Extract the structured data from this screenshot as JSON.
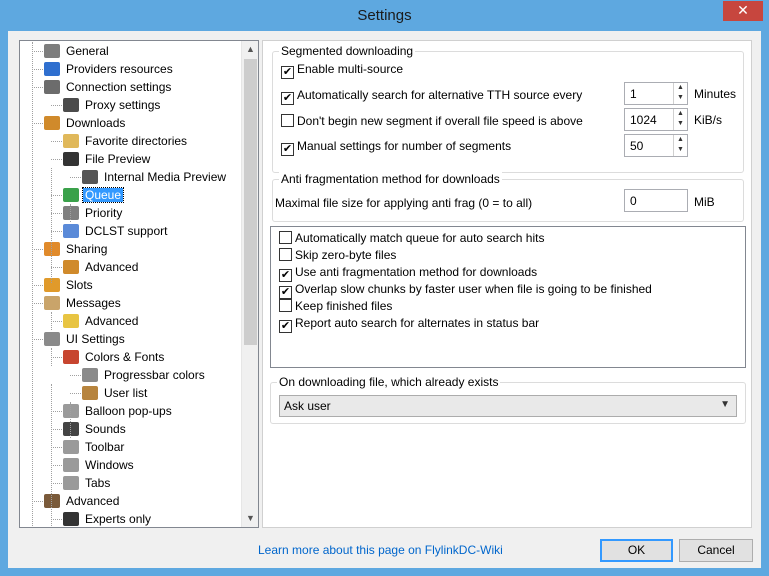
{
  "window": {
    "title": "Settings",
    "close_glyph": "✕"
  },
  "tree": {
    "items": [
      {
        "label": "General",
        "icon": "general-icon",
        "color": "#7d7d7d"
      },
      {
        "label": "Providers resources",
        "icon": "globe-icon",
        "color": "#2f6fcf"
      },
      {
        "label": "Connection settings",
        "icon": "network-icon",
        "color": "#6c6c6c"
      },
      {
        "label": "Proxy settings",
        "icon": "proxy-icon",
        "color": "#4b4b4b"
      },
      {
        "label": "Downloads",
        "icon": "download-icon",
        "color": "#d08a2b"
      },
      {
        "label": "Favorite directories",
        "icon": "folder-icon",
        "color": "#e0b85a"
      },
      {
        "label": "File Preview",
        "icon": "film-icon",
        "color": "#333333"
      },
      {
        "label": "Internal Media Preview",
        "icon": "media-icon",
        "color": "#555555"
      },
      {
        "label": "Queue",
        "icon": "queue-icon",
        "color": "#3aa14a"
      },
      {
        "label": "Priority",
        "icon": "priority-icon",
        "color": "#7f7f7f"
      },
      {
        "label": "DCLST support",
        "icon": "dclst-icon",
        "color": "#5a8ad8"
      },
      {
        "label": "Sharing",
        "icon": "sharing-icon",
        "color": "#e08a2b"
      },
      {
        "label": "Advanced",
        "icon": "advanced-arrows-icon",
        "color": "#d08a2b"
      },
      {
        "label": "Slots",
        "icon": "slots-icon",
        "color": "#e09a2b"
      },
      {
        "label": "Messages",
        "icon": "messages-icon",
        "color": "#c9a46a"
      },
      {
        "label": "Advanced",
        "icon": "chat-icon",
        "color": "#e8c442"
      },
      {
        "label": "UI Settings",
        "icon": "ui-icon",
        "color": "#8a8a8a"
      },
      {
        "label": "Colors & Fonts",
        "icon": "palette-icon",
        "color": "#c7452f"
      },
      {
        "label": "Progressbar colors",
        "icon": "progressbar-icon",
        "color": "#8a8a8a"
      },
      {
        "label": "User list",
        "icon": "users-icon",
        "color": "#b7843e"
      },
      {
        "label": "Balloon pop-ups",
        "icon": "balloon-icon",
        "color": "#9a9a9a"
      },
      {
        "label": "Sounds",
        "icon": "speaker-icon",
        "color": "#444444"
      },
      {
        "label": "Toolbar",
        "icon": "toolbar-icon",
        "color": "#9a9a9a"
      },
      {
        "label": "Windows",
        "icon": "windows-icon",
        "color": "#9a9a9a"
      },
      {
        "label": "Tabs",
        "icon": "tabs-icon",
        "color": "#9a9a9a"
      },
      {
        "label": "Advanced",
        "icon": "tools-icon",
        "color": "#7a5a3a"
      },
      {
        "label": "Experts only",
        "icon": "expert-icon",
        "color": "#333333"
      }
    ],
    "selected_label": "Queue"
  },
  "segmented": {
    "title": "Segmented downloading",
    "enable_multisource": "Enable multi-source",
    "auto_search": "Automatically search for alternative TTH source every",
    "auto_search_value": "1",
    "auto_search_unit": "Minutes",
    "dont_begin": "Don't begin new segment if overall file speed is above",
    "dont_begin_value": "1024",
    "dont_begin_unit": "KiB/s",
    "manual_segments": "Manual settings for number of segments",
    "manual_segments_value": "50"
  },
  "antifrag": {
    "title": "Anti fragmentation method for downloads",
    "label": "Maximal file size for applying anti frag (0 = to all)",
    "value": "0",
    "unit": "MiB"
  },
  "options": [
    {
      "label": "Automatically match queue for auto search hits",
      "checked": false
    },
    {
      "label": "Skip zero-byte files",
      "checked": false
    },
    {
      "label": "Use anti fragmentation method for downloads",
      "checked": true
    },
    {
      "label": "Overlap slow chunks by faster user when file is going to be finished",
      "checked": true
    },
    {
      "label": "Keep finished files",
      "checked": false
    },
    {
      "label": "Report auto search for alternates in status bar",
      "checked": true
    }
  ],
  "existing": {
    "title": "On downloading file, which already exists",
    "selected": "Ask user"
  },
  "footer": {
    "link": "Learn more about this page on FlylinkDC-Wiki",
    "ok": "OK",
    "cancel": "Cancel"
  },
  "check_glyph": "✔"
}
